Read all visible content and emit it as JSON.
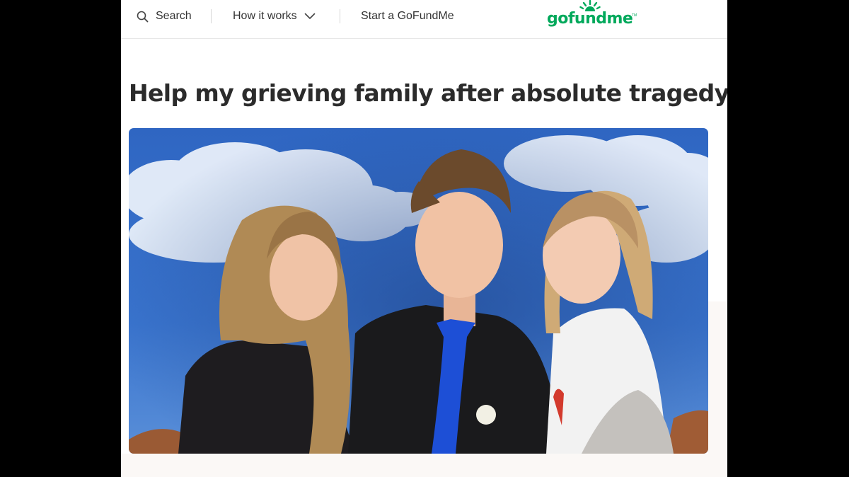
{
  "header": {
    "search_label": "Search",
    "how_it_works_label": "How it works",
    "start_label": "Start a GoFundMe",
    "logo_text": "gofundme",
    "logo_tm": "TM",
    "brand_color": "#02a95c"
  },
  "campaign": {
    "title": "Help my grieving family after absolute tragedy"
  },
  "icons": {
    "search": "search-icon",
    "chevron": "chevron-down-icon"
  }
}
